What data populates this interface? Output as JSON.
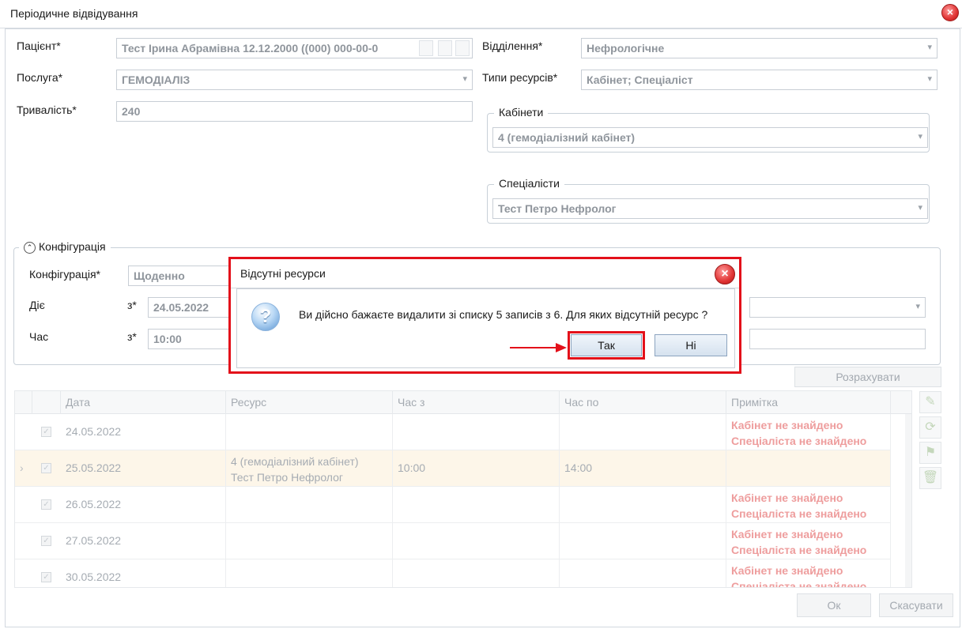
{
  "window": {
    "title": "Періодичне відвідування",
    "close_glyph": "×"
  },
  "form": {
    "patient_label": "Пацієнт*",
    "patient_value": "Тест Ірина Абрамівна 12.12.2000 ((000) 000-00-0",
    "service_label": "Послуга*",
    "service_value": "ГЕМОДІАЛІЗ",
    "duration_label": "Тривалість*",
    "duration_value": "240",
    "department_label": "Відділення*",
    "department_value": "Нефрологічне",
    "resource_types_label": "Типи ресурсів*",
    "resource_types_value": "Кабінет; Спеціаліст",
    "cabinets_legend": "Кабінети",
    "cabinets_value": "4 (гемодіалізний кабінет)",
    "specialists_legend": "Спеціалісти",
    "specialists_value": "Тест Петро Нефролог"
  },
  "config": {
    "legend": "Конфігурація",
    "config_label": "Конфігурація*",
    "config_value": "Щоденно",
    "acts_label": "Діє",
    "from_label": "з*",
    "date_from_value": "24.05.2022",
    "time_label": "Час",
    "time_from_label": "з*",
    "time_from_value": "10:00"
  },
  "calculate_label": "Розрахувати",
  "grid": {
    "columns": [
      "Дата",
      "Ресурс",
      "Час з",
      "Час по",
      "Примітка"
    ],
    "rows": [
      {
        "date": "24.05.2022",
        "resource1": "",
        "resource2": "",
        "from": "",
        "to": "",
        "note1": "Кабінет не знайдено",
        "note2": "Спеціаліста не знайдено"
      },
      {
        "date": "25.05.2022",
        "resource1": "4 (гемодіалізний кабінет)",
        "resource2": "Тест Петро Нефролог",
        "from": "10:00",
        "to": "14:00",
        "note1": "",
        "note2": ""
      },
      {
        "date": "26.05.2022",
        "resource1": "",
        "resource2": "",
        "from": "",
        "to": "",
        "note1": "Кабінет не знайдено",
        "note2": "Спеціаліста не знайдено"
      },
      {
        "date": "27.05.2022",
        "resource1": "",
        "resource2": "",
        "from": "",
        "to": "",
        "note1": "Кабінет не знайдено",
        "note2": "Спеціаліста не знайдено"
      },
      {
        "date": "30.05.2022",
        "resource1": "",
        "resource2": "",
        "from": "",
        "to": "",
        "note1": "Кабінет не знайдено",
        "note2": "Спеціаліста не знайдено"
      }
    ],
    "checked_glyph": "✓",
    "current_row_glyph": "›"
  },
  "footer": {
    "ok_label": "Ок",
    "cancel_label": "Скасувати"
  },
  "dialog": {
    "title": "Відсутні ресурси",
    "message": "Ви дійсно бажаєте видалити зі списку 5 записів з 6. Для яких відсутній ресурс ?",
    "yes_label": "Так",
    "no_label": "Ні",
    "question_glyph": "?",
    "close_glyph": "×",
    "highlight_color": "#e3101a"
  }
}
